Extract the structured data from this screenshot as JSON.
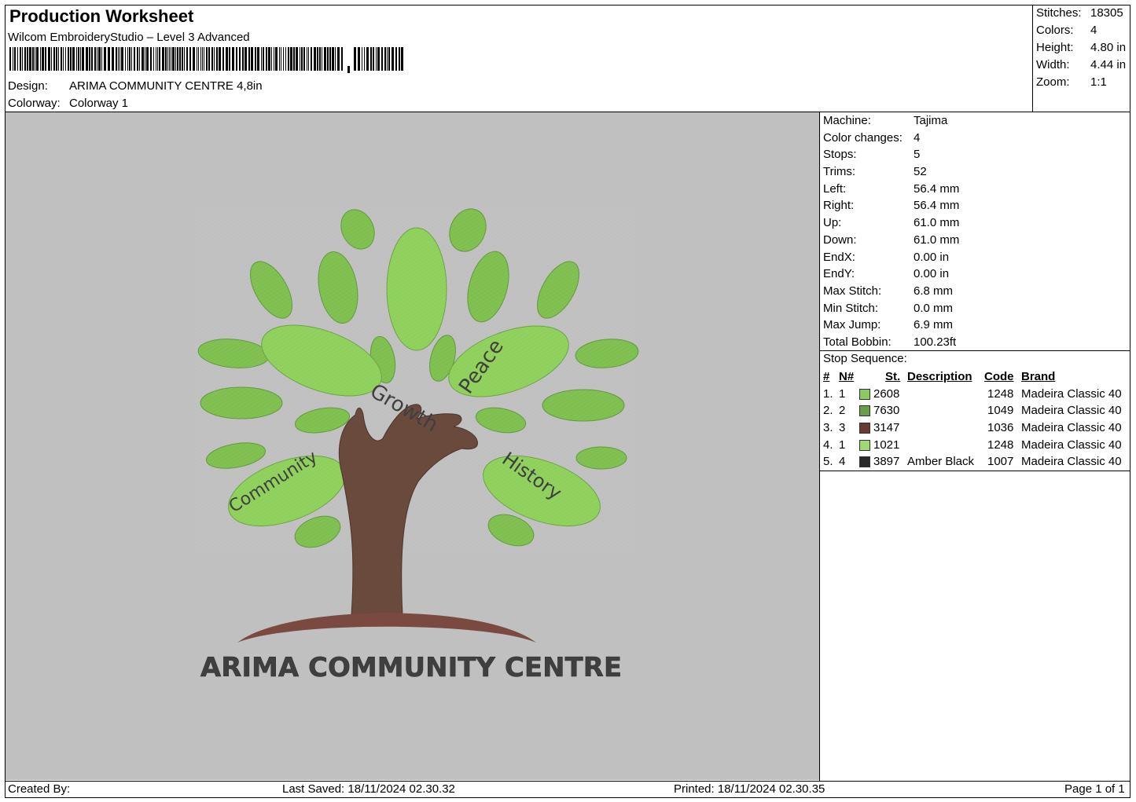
{
  "header": {
    "title": "Production Worksheet",
    "software": "Wilcom EmbroideryStudio – Level 3 Advanced",
    "design_label": "Design:",
    "design_value": "ARIMA COMMUNITY CENTRE 4,8in",
    "colorway_label": "Colorway:",
    "colorway_value": "Colorway 1"
  },
  "stats": [
    {
      "label": "Stitches:",
      "value": "18305"
    },
    {
      "label": "Colors:",
      "value": "4"
    },
    {
      "label": "Height:",
      "value": "4.80 in"
    },
    {
      "label": "Width:",
      "value": "4.44 in"
    },
    {
      "label": "Zoom:",
      "value": "1:1"
    }
  ],
  "machine_info": [
    {
      "label": "Machine:",
      "value": "Tajima"
    },
    {
      "label": "Color changes:",
      "value": "4"
    },
    {
      "label": "Stops:",
      "value": "5"
    },
    {
      "label": "Trims:",
      "value": "52"
    },
    {
      "label": "Left:",
      "value": "56.4 mm"
    },
    {
      "label": "Right:",
      "value": "56.4 mm"
    },
    {
      "label": "Up:",
      "value": "61.0 mm"
    },
    {
      "label": "Down:",
      "value": "61.0 mm"
    },
    {
      "label": "EndX:",
      "value": "0.00 in"
    },
    {
      "label": "EndY:",
      "value": "0.00 in"
    },
    {
      "label": "Max Stitch:",
      "value": "6.8 mm"
    },
    {
      "label": "Min Stitch:",
      "value": "0.0 mm"
    },
    {
      "label": "Max Jump:",
      "value": "6.9 mm"
    },
    {
      "label": "Total Bobbin:",
      "value": "100.23ft"
    }
  ],
  "stop_sequence": {
    "title": "Stop Sequence:",
    "headers": {
      "num": "#",
      "n": "N#",
      "st": "St.",
      "description": "Description",
      "code": "Code",
      "brand": "Brand"
    },
    "rows": [
      {
        "num": "1.",
        "n": "1",
        "color": "#8cc864",
        "st": "2608",
        "description": "",
        "code": "1248",
        "brand": "Madeira Classic 40"
      },
      {
        "num": "2.",
        "n": "2",
        "color": "#6a9e48",
        "st": "7630",
        "description": "",
        "code": "1049",
        "brand": "Madeira Classic 40"
      },
      {
        "num": "3.",
        "n": "3",
        "color": "#6b3a30",
        "st": "3147",
        "description": "",
        "code": "1036",
        "brand": "Madeira Classic 40"
      },
      {
        "num": "4.",
        "n": "1",
        "color": "#a0d878",
        "st": "1021",
        "description": "",
        "code": "1248",
        "brand": "Madeira Classic 40"
      },
      {
        "num": "5.",
        "n": "4",
        "color": "#2a2a2a",
        "st": "3897",
        "description": "Amber Black",
        "code": "1007",
        "brand": "Madeira Classic 40"
      }
    ]
  },
  "design": {
    "leaf_words": [
      "Growth",
      "Peace",
      "Community",
      "History"
    ],
    "caption": "ARIMA COMMUNITY CENTRE",
    "colors": {
      "leaf_light": "#8dc85f",
      "leaf_mid": "#7fbf4f",
      "trunk": "#6b4a3e",
      "ground": "#7a4a40",
      "text": "#3f3f3f",
      "background": "#c0c0c0"
    }
  },
  "footer": {
    "created_by": "Created By:",
    "last_saved": "Last Saved: 18/11/2024 02.30.32",
    "printed": "Printed: 18/11/2024 02.30.35",
    "page": "Page 1 of 1"
  }
}
